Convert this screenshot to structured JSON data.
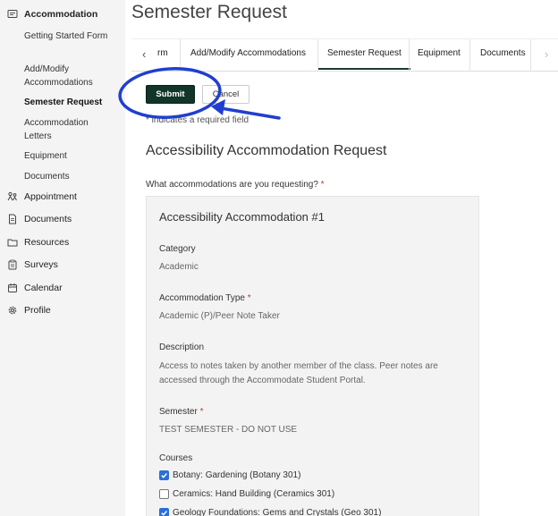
{
  "sidebar": {
    "heading": "Accommodation",
    "sub_items": [
      {
        "label": "Getting Started Form"
      },
      {
        "label": "Add/Modify Accommodations"
      },
      {
        "label": "Semester Request"
      },
      {
        "label": "Accommodation Letters"
      },
      {
        "label": "Equipment"
      },
      {
        "label": "Documents"
      }
    ],
    "items": [
      {
        "label": "Appointment",
        "icon": "appointment-icon"
      },
      {
        "label": "Documents",
        "icon": "document-icon"
      },
      {
        "label": "Resources",
        "icon": "folder-icon"
      },
      {
        "label": "Surveys",
        "icon": "clipboard-icon"
      },
      {
        "label": "Calendar",
        "icon": "calendar-icon"
      },
      {
        "label": "Profile",
        "icon": "gear-icon"
      }
    ]
  },
  "page": {
    "title": "Semester Request"
  },
  "tabs": {
    "items": [
      {
        "label": "rm"
      },
      {
        "label": "Add/Modify Accommodations"
      },
      {
        "label": "Semester Request",
        "active": true
      },
      {
        "label": "Equipment"
      },
      {
        "label": "Documents"
      }
    ]
  },
  "actions": {
    "submit_label": "Submit",
    "cancel_label": "Cancel"
  },
  "form": {
    "required_note": "* indicates a required field",
    "heading": "Accessibility Accommodation Request",
    "question": "What accommodations are you requesting?",
    "required_mark": "*"
  },
  "accommodation": {
    "title": "Accessibility Accommodation #1",
    "category_label": "Category",
    "category_value": "Academic",
    "type_label": "Accommodation Type",
    "type_value": "Academic (P)/Peer Note Taker",
    "description_label": "Description",
    "description_value": "Access to notes taken by another member of the class. Peer notes are accessed through the Accommodate Student Portal.",
    "semester_label": "Semester",
    "semester_value": "TEST SEMESTER - DO NOT USE",
    "courses_label": "Courses",
    "courses": [
      {
        "label": "Botany: Gardening (Botany 301)",
        "checked": true
      },
      {
        "label": "Ceramics: Hand Building (Ceramics 301)",
        "checked": false
      },
      {
        "label": "Geology Foundations: Gems and Crystals (Geo 301)",
        "checked": true
      }
    ]
  },
  "colors": {
    "submit_bg": "#12352a",
    "annotation": "#1f3fcf",
    "checkbox": "#2a6fd6",
    "required": "#c0392b"
  }
}
